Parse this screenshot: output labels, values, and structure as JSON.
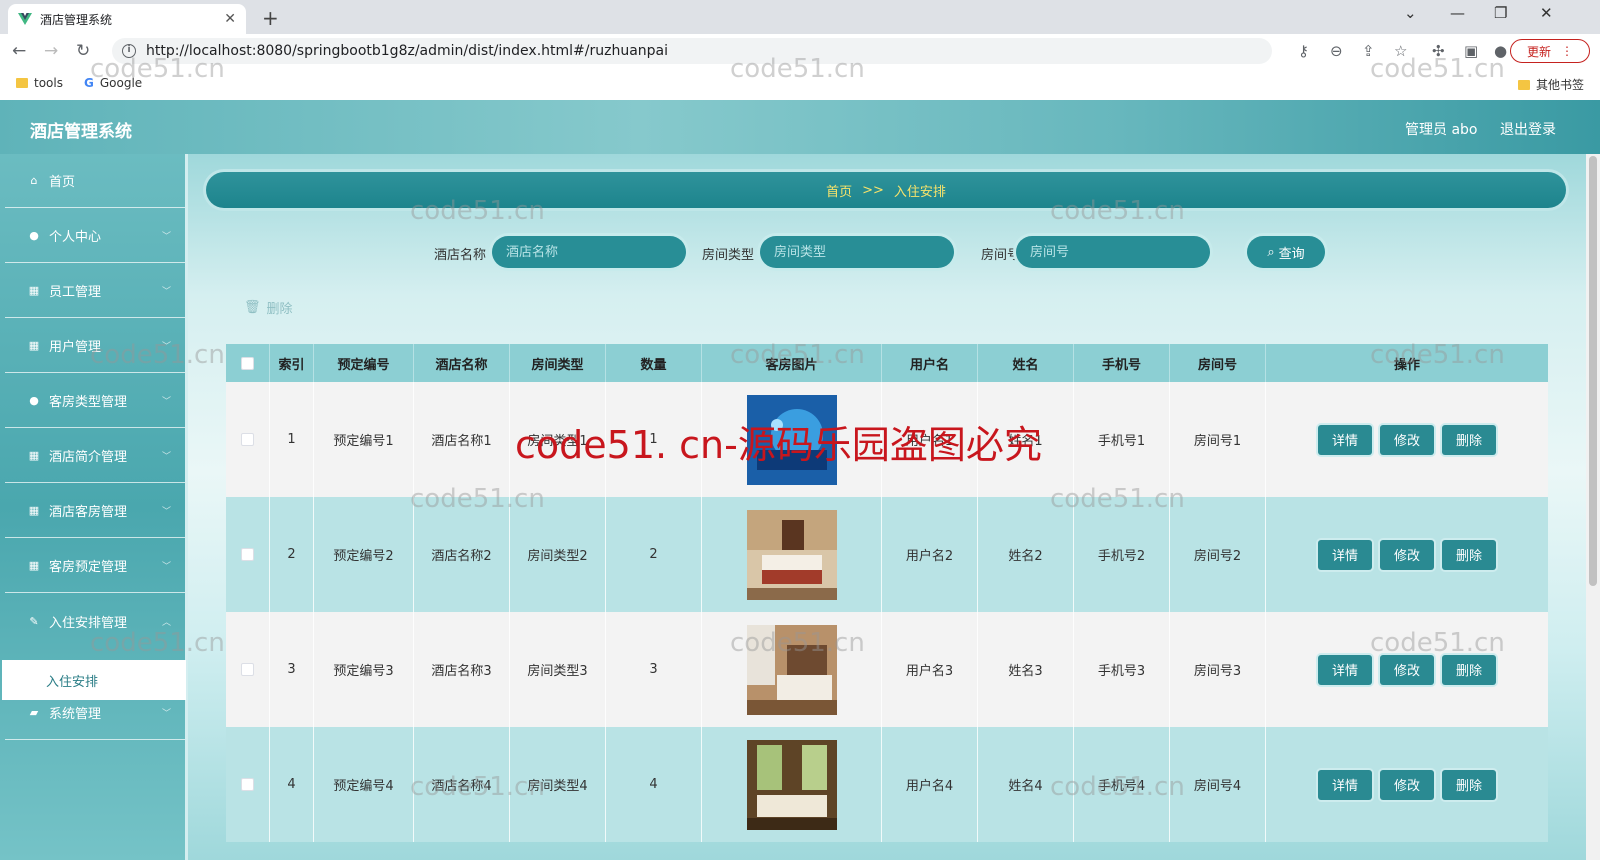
{
  "browser": {
    "tab_title": "酒店管理系统",
    "url": "http://localhost:8080/springbootb1g8z/admin/dist/index.html#/ruzhuanpai",
    "update_label": "更新",
    "bookmarks": [
      "tools",
      "Google"
    ],
    "other_bookmarks": "其他书签"
  },
  "header": {
    "app_title": "酒店管理系统",
    "user": "管理员 abo",
    "logout": "退出登录"
  },
  "sidebar": {
    "items": [
      {
        "label": "首页",
        "icon": "home-icon"
      },
      {
        "label": "个人中心",
        "icon": "user-icon"
      },
      {
        "label": "员工管理",
        "icon": "grid-icon"
      },
      {
        "label": "用户管理",
        "icon": "grid-icon"
      },
      {
        "label": "客房类型管理",
        "icon": "user-icon"
      },
      {
        "label": "酒店简介管理",
        "icon": "grid-icon"
      },
      {
        "label": "酒店客房管理",
        "icon": "grid-icon"
      },
      {
        "label": "客房预定管理",
        "icon": "grid-icon"
      },
      {
        "label": "入住安排管理",
        "icon": "pencil-icon"
      },
      {
        "label": "系统管理",
        "icon": "briefcase-icon"
      }
    ],
    "active_sub": "入住安排"
  },
  "breadcrumb": {
    "home": "首页",
    "sep": ">>",
    "current": "入住安排"
  },
  "search": {
    "hotel_label": "酒店名称",
    "hotel_placeholder": "酒店名称",
    "type_label": "房间类型",
    "type_placeholder": "房间类型",
    "room_label": "房间号",
    "room_placeholder": "房间号",
    "button": "查询"
  },
  "actions": {
    "delete": "删除"
  },
  "table": {
    "headers": [
      "索引",
      "预定编号",
      "酒店名称",
      "房间类型",
      "数量",
      "客房图片",
      "用户名",
      "姓名",
      "手机号",
      "房间号",
      "操作"
    ],
    "rows": [
      {
        "index": "1",
        "order": "预定编号1",
        "hotel": "酒店名称1",
        "type": "房间类型1",
        "qty": "1",
        "user": "用户名1",
        "name": "姓名1",
        "phone": "手机号1",
        "room": "房间号1"
      },
      {
        "index": "2",
        "order": "预定编号2",
        "hotel": "酒店名称2",
        "type": "房间类型2",
        "qty": "2",
        "user": "用户名2",
        "name": "姓名2",
        "phone": "手机号2",
        "room": "房间号2"
      },
      {
        "index": "3",
        "order": "预定编号3",
        "hotel": "酒店名称3",
        "type": "房间类型3",
        "qty": "3",
        "user": "用户名3",
        "name": "姓名3",
        "phone": "手机号3",
        "room": "房间号3"
      },
      {
        "index": "4",
        "order": "预定编号4",
        "hotel": "酒店名称4",
        "type": "房间类型4",
        "qty": "4",
        "user": "用户名4",
        "name": "姓名4",
        "phone": "手机号4",
        "room": "房间号4"
      }
    ],
    "btn_detail": "详情",
    "btn_edit": "修改",
    "btn_delete": "删除"
  },
  "watermarks": {
    "small": "code51.cn",
    "big": "code51. cn-源码乐园盗图必究"
  },
  "colors": {
    "primary": "#288e96",
    "header_gradient_start": "#5fb3b9",
    "breadcrumb_text": "#f7e36b",
    "watermark_red": "#c8161d"
  }
}
